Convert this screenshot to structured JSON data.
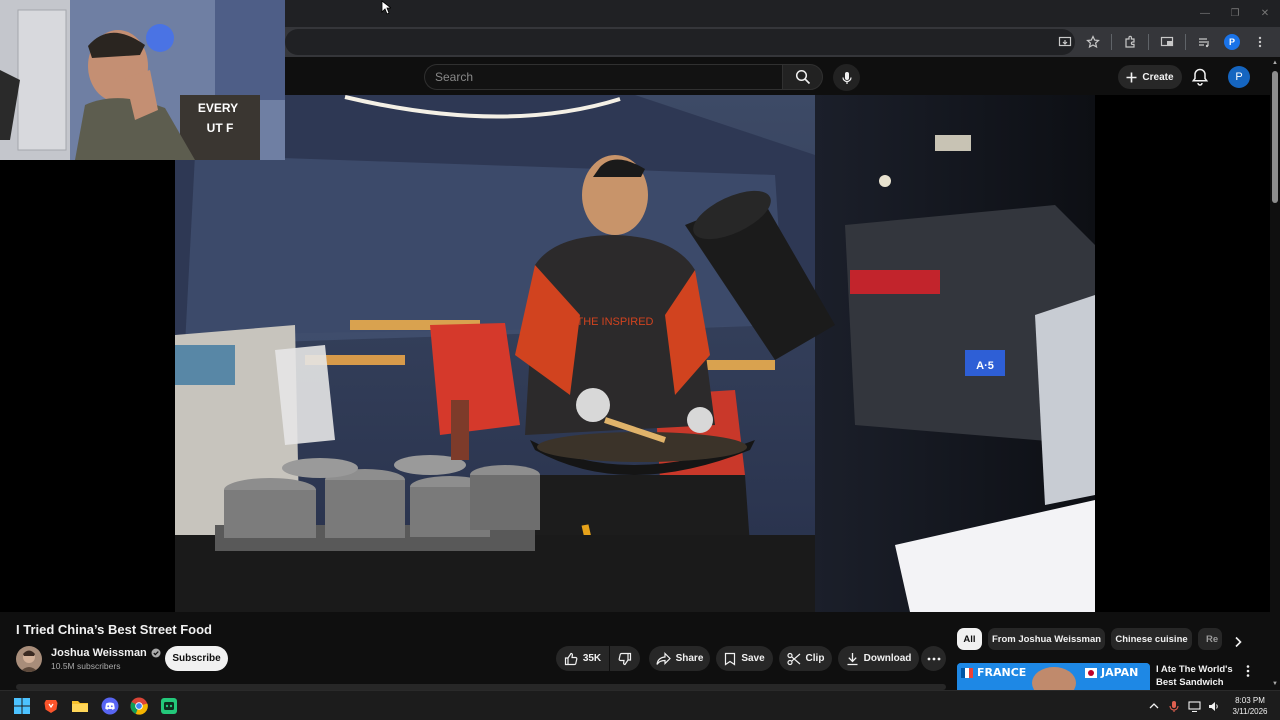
{
  "browser": {
    "window_controls": [
      "minimize-icon",
      "restore-icon",
      "close-icon"
    ],
    "toolbar_icons": [
      "install-app-icon",
      "bookmark-star-icon",
      "extensions-icon",
      "split-view-icon",
      "media-controls-icon",
      "profile-icon",
      "kebab-menu-icon"
    ],
    "profile_initial": "P"
  },
  "header": {
    "search_placeholder": "Search",
    "create_label": "Create",
    "avatar_initial": "P"
  },
  "video": {
    "title": "I Tried China’s Best Street Food",
    "shirt_text": "THE INSPIRED",
    "plate_text": "A·5"
  },
  "channel": {
    "name": "Joshua Weissman",
    "verified": true,
    "subscribers": "10.5M subscribers",
    "subscribe_label": "Subscribe"
  },
  "actions": {
    "likes": "35K",
    "share": "Share",
    "save": "Save",
    "clip": "Clip",
    "download": "Download"
  },
  "chips": [
    {
      "label": "All",
      "active": true
    },
    {
      "label": "From Joshua Weissman",
      "active": false
    },
    {
      "label": "Chinese cuisine",
      "active": false
    },
    {
      "label": "Re",
      "active": false
    }
  ],
  "related": {
    "thumb_left_label": "FRANCE",
    "thumb_right_label": "JAPAN",
    "title_line1": "I Ate The World's",
    "title_line2": "Best Sandwich"
  },
  "taskbar": {
    "apps": [
      "windows-start-icon",
      "brave-browser-icon",
      "file-explorer-icon",
      "discord-icon",
      "chrome-icon",
      "app-icon"
    ],
    "time": "8:03 PM",
    "date": "3/11/2026"
  }
}
